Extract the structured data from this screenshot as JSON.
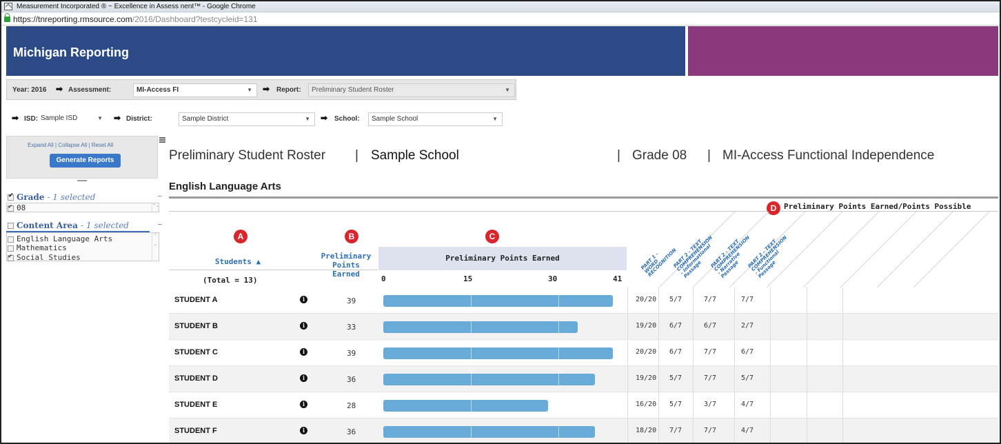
{
  "browser": {
    "window_title": "Measurement Incorporated ® ~ Excellence in Assess nent™ - Google Chrome",
    "url_host": "https://tnreporting.rmsource.com",
    "url_path": "/2016/Dashboard?testcycleid=131"
  },
  "header": {
    "title": "Michigan Reporting",
    "accent_color": "#8a3a7c",
    "brand_color": "#2c4a85"
  },
  "filters": {
    "year_label": "Year: 2016",
    "assessment_label": "Assessment:",
    "assessment_value": "MI-Access FI",
    "report_label": "Report:",
    "report_value": "Preliminary Student Roster",
    "isd_label": "ISD:",
    "isd_value": "Sample ISD",
    "district_label": "District:",
    "district_value": "Sample District",
    "school_label": "School:",
    "school_value": "Sample School"
  },
  "sidebar": {
    "expand_all": "Expand All",
    "collapse_all": "Collapse All",
    "reset_all": "Reset All",
    "generate_button": "Generate Reports",
    "grade_facet": {
      "title": "Grade",
      "selected": "- 1 selected",
      "items": [
        {
          "label": "08",
          "checked": true
        }
      ]
    },
    "content_facet": {
      "title": "Content Area",
      "selected": "- 1 selected",
      "items": [
        {
          "label": "English Language Arts",
          "checked": false
        },
        {
          "label": "Mathematics",
          "checked": false
        },
        {
          "label": "Social Studies",
          "checked": true
        }
      ]
    }
  },
  "report": {
    "title": "Preliminary Student Roster",
    "school": "Sample School",
    "grade": "Grade 08",
    "assessment": "MI-Access Functional Independence",
    "subject": "English Language Arts",
    "points_header": "Preliminary Points Earned/Points Possible",
    "badges": [
      "A",
      "B",
      "C",
      "D"
    ],
    "students_header": "Students ▲",
    "total": "(Total = 13)",
    "ppe_col_line1": "Preliminary",
    "ppe_col_line2": "Points",
    "ppe_col_line3": "Earned",
    "bar_header": "Preliminary Points Earned",
    "scale": [
      "0",
      "15",
      "30",
      "41"
    ],
    "scale_max": 41,
    "sub_headers": [
      [
        "PART 1 -",
        "WORD",
        "RECOGNITION"
      ],
      [
        "PART 2 - TEXT",
        "COMPREHENSION",
        "- Informational",
        "Passage"
      ],
      [
        "PART 2 - TEXT",
        "COMPREHENSION",
        "- Narrative",
        "Passage"
      ],
      [
        "PART 2 - TEXT",
        "COMPREHENSION",
        "- Functional",
        "Passage"
      ]
    ],
    "info_glyph": "i",
    "students": [
      {
        "name": "STUDENT A",
        "points": "39",
        "value": 39,
        "parts": [
          "20/20",
          "5/7",
          "7/7",
          "7/7"
        ]
      },
      {
        "name": "STUDENT B",
        "points": "33",
        "value": 33,
        "parts": [
          "19/20",
          "6/7",
          "6/7",
          "2/7"
        ]
      },
      {
        "name": "STUDENT C",
        "points": "39",
        "value": 39,
        "parts": [
          "20/20",
          "6/7",
          "7/7",
          "6/7"
        ]
      },
      {
        "name": "STUDENT D",
        "points": "36",
        "value": 36,
        "parts": [
          "19/20",
          "5/7",
          "7/7",
          "5/7"
        ]
      },
      {
        "name": "STUDENT E",
        "points": "28",
        "value": 28,
        "parts": [
          "16/20",
          "5/7",
          "3/7",
          "4/7"
        ]
      },
      {
        "name": "STUDENT F",
        "points": "36",
        "value": 36,
        "parts": [
          "18/20",
          "7/7",
          "7/7",
          "4/7"
        ]
      }
    ]
  }
}
